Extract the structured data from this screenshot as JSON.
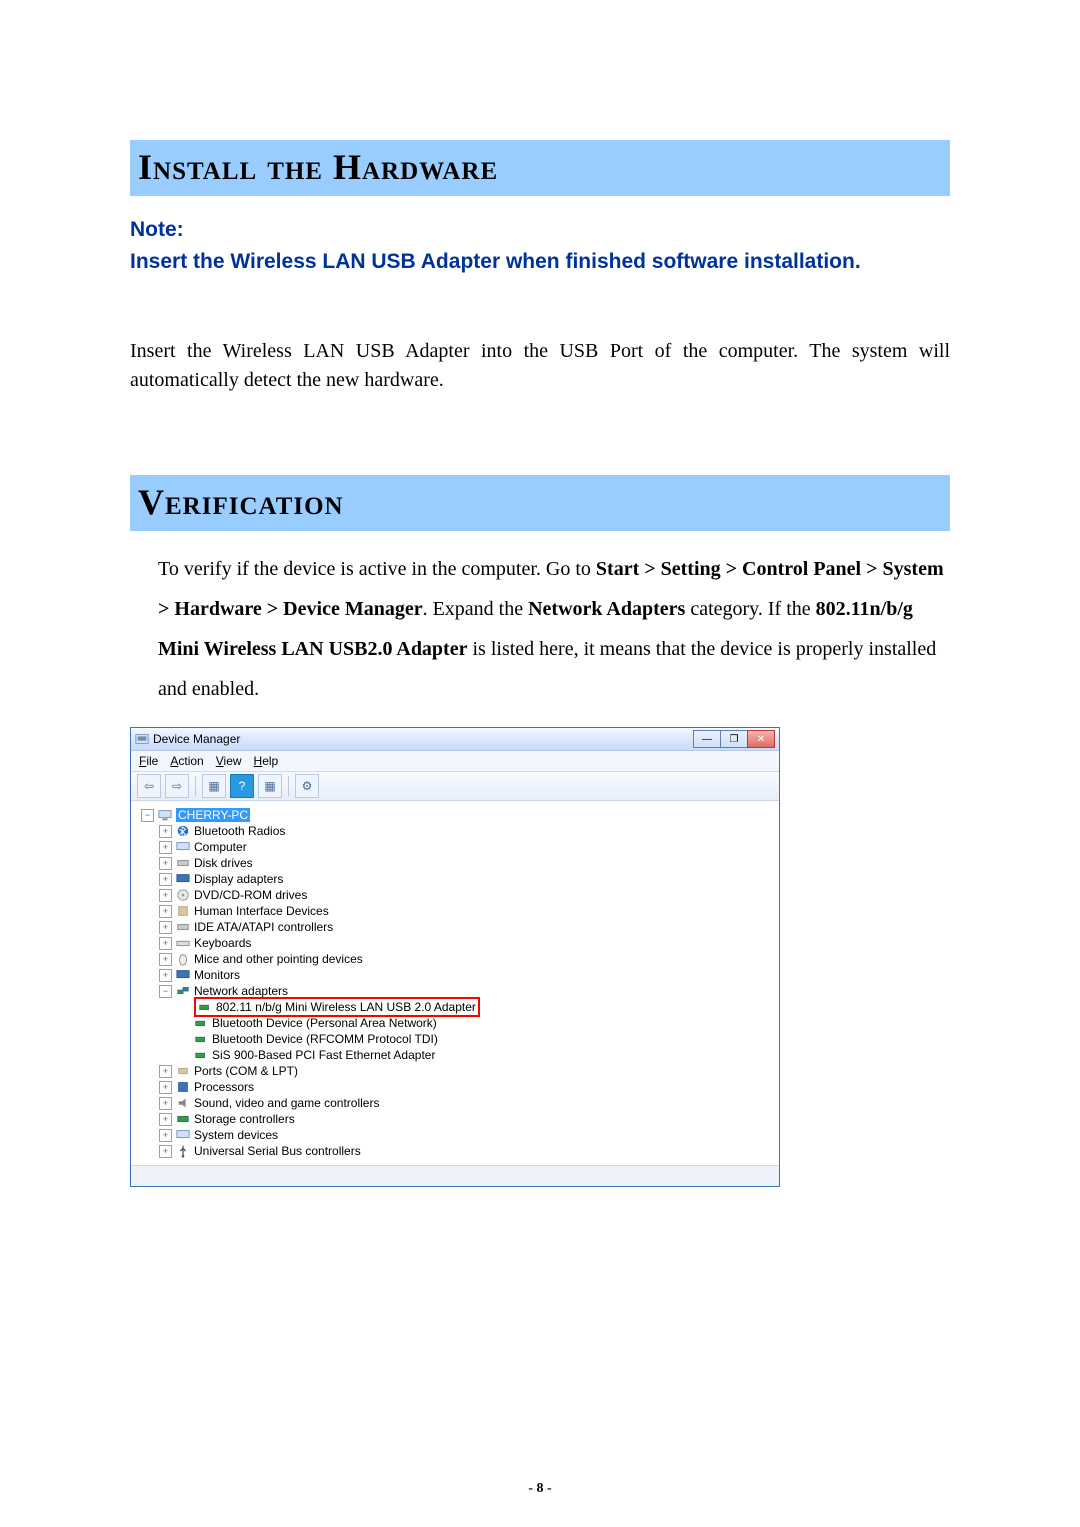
{
  "headings": {
    "install": "Install the Hardware",
    "verification": "Verification"
  },
  "note": {
    "label": "Note:",
    "text": "Insert the Wireless LAN USB Adapter when finished software installation."
  },
  "install_body": "Insert the Wireless LAN USB Adapter into the USB Port of the computer. The system will automatically detect the new hardware.",
  "verify": {
    "p1_a": "To verify if the device is active in the computer. Go to ",
    "p1_b": "Start > Setting > Control Panel > System > Hardware > Device Manager",
    "p1_c": ". Expand the ",
    "p1_d": "Network Adapters",
    "p1_e": " category. If the ",
    "p1_f": "802.11n/b/g Mini Wireless LAN USB2.0 Adapter",
    "p1_g": " is listed here, it means that the device is properly installed and enabled."
  },
  "dm": {
    "title": "Device Manager",
    "menu": {
      "file": "File",
      "action": "Action",
      "view": "View",
      "help": "Help"
    },
    "win": {
      "min": "—",
      "max": "❐",
      "close": "✕"
    },
    "tree": {
      "root": "CHERRY-PC",
      "bluetooth_radios": "Bluetooth Radios",
      "computer": "Computer",
      "disk_drives": "Disk drives",
      "display_adapters": "Display adapters",
      "dvd": "DVD/CD-ROM drives",
      "hid": "Human Interface Devices",
      "ide": "IDE ATA/ATAPI controllers",
      "keyboards": "Keyboards",
      "mice": "Mice and other pointing devices",
      "monitors": "Monitors",
      "network_adapters": "Network adapters",
      "adapter1": "802.11 n/b/g Mini Wireless LAN USB 2.0 Adapter",
      "adapter2": "Bluetooth Device (Personal Area Network)",
      "adapter3": "Bluetooth Device (RFCOMM Protocol TDI)",
      "adapter4": "SiS 900-Based PCI Fast Ethernet Adapter",
      "ports": "Ports (COM & LPT)",
      "processors": "Processors",
      "sound": "Sound, video and game controllers",
      "storage": "Storage controllers",
      "system": "System devices",
      "usb": "Universal Serial Bus controllers"
    }
  },
  "page_number": "- 8 -"
}
